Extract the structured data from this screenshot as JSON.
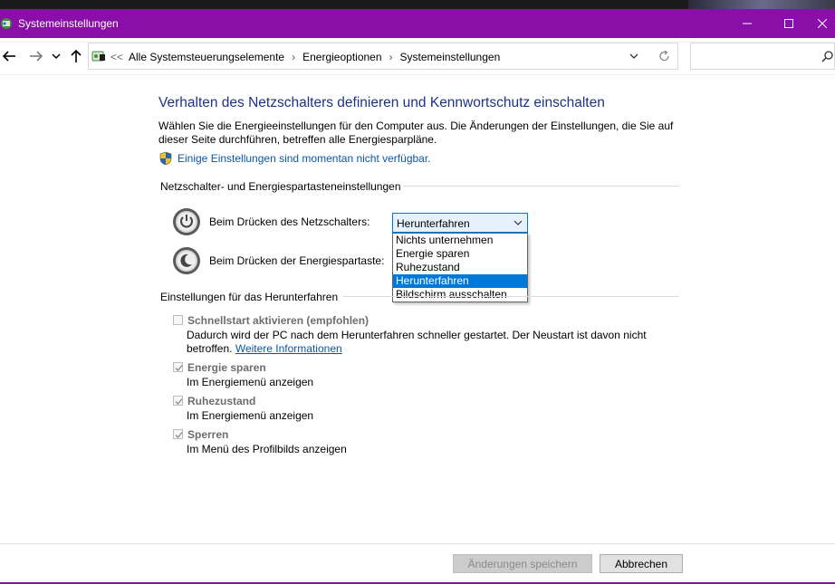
{
  "window": {
    "title": "Systemeinstellungen",
    "accent_color": "#8a0fa8"
  },
  "icons": {
    "app": "control-panel-icon",
    "back": "arrow-left-icon",
    "forward": "arrow-right-icon",
    "recent": "chevron-down-icon",
    "up": "arrow-up-icon",
    "refresh": "refresh-icon",
    "search": "search-icon",
    "shield": "uac-shield-icon",
    "power_button": "power-button-icon",
    "sleep_button": "sleep-button-icon"
  },
  "address": {
    "overflow": "<<",
    "crumbs": [
      "Alle Systemsteuerungselemente",
      "Energieoptionen",
      "Systemeinstellungen"
    ],
    "separator": "›"
  },
  "search": {
    "placeholder": "",
    "value": ""
  },
  "main": {
    "heading": "Verhalten des Netzschalters definieren und Kennwortschutz einschalten",
    "description_line1": "Wählen Sie die Energieeinstellungen für den Computer aus. Die Änderungen der Einstellungen, die Sie auf",
    "description_line2": "dieser Seite durchführen, betreffen alle Energiesparpläne.",
    "unavailable_link": "Einige Einstellungen sind momentan nicht verfügbar.",
    "power_group_label": "Netzschalter- und Energiespartasteneinstellungen",
    "power_button_label": "Beim Drücken des Netzschalters:",
    "sleep_button_label": "Beim Drücken der Energiespartaste:",
    "power_button_value": "Herunterfahren",
    "dropdown_options": [
      "Nichts unternehmen",
      "Energie sparen",
      "Ruhezustand",
      "Herunterfahren",
      "Bildschirm ausschalten"
    ],
    "dropdown_selected_index": 3,
    "shutdown_group_label": "Einstellungen für das Herunterfahren",
    "options": [
      {
        "label": "Schnellstart aktivieren (empfohlen)",
        "checked": false,
        "desc_line1": "Dadurch wird der PC nach dem Herunterfahren schneller gestartet. Der Neustart ist davon nicht",
        "desc_line2": "betroffen.",
        "link": "Weitere Informationen"
      },
      {
        "label": "Energie sparen",
        "checked": true,
        "desc_line1": "Im Energiemenü anzeigen"
      },
      {
        "label": "Ruhezustand",
        "checked": true,
        "desc_line1": "Im Energiemenü anzeigen"
      },
      {
        "label": "Sperren",
        "checked": true,
        "desc_line1": "Im Menü des Profilbilds anzeigen"
      }
    ]
  },
  "footer": {
    "save_label": "Änderungen speichern",
    "cancel_label": "Abbrechen"
  }
}
